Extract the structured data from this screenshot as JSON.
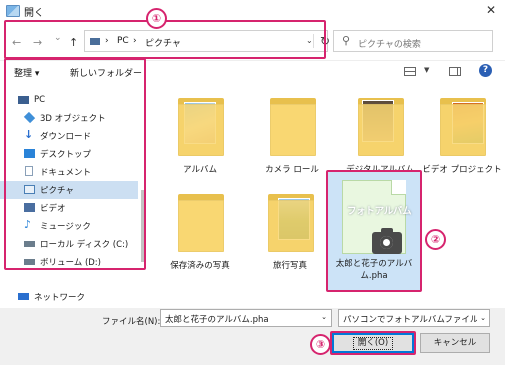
{
  "window": {
    "title": "開く",
    "close_symbol": "✕"
  },
  "nav": {
    "back": "←",
    "forward": "→",
    "recent": "⌄",
    "up": "↑"
  },
  "address": {
    "segments": [
      "PC",
      "›",
      "ピクチャ"
    ],
    "lead_sep": "›",
    "dropdown": "⌄",
    "refresh": "↻"
  },
  "search": {
    "icon": "⚲",
    "placeholder": "ピクチャの検索"
  },
  "toolbar": {
    "organize": "整理 ▾",
    "new_folder": "新しいフォルダー",
    "view_dd": "▼",
    "help": "?"
  },
  "sidebar": {
    "items": [
      {
        "label": "PC",
        "icon": "pc-icon",
        "color": "#3b5f8f"
      },
      {
        "label": "3D オブジェクト",
        "icon": "3d-objects-icon",
        "color": "#3f8fd8"
      },
      {
        "label": "ダウンロード",
        "icon": "download-icon",
        "color": "#2a6fcf"
      },
      {
        "label": "デスクトップ",
        "icon": "desktop-icon",
        "color": "#2a83d8"
      },
      {
        "label": "ドキュメント",
        "icon": "documents-icon",
        "color": "#8aa0b8"
      },
      {
        "label": "ピクチャ",
        "icon": "pictures-icon",
        "color": "#4a7fb5",
        "selected": true
      },
      {
        "label": "ビデオ",
        "icon": "videos-icon",
        "color": "#4a6ea0"
      },
      {
        "label": "ミュージック",
        "icon": "music-icon",
        "color": "#2a83d8"
      },
      {
        "label": "ローカル ディスク (C:)",
        "icon": "local-disk-icon",
        "color": "#6b7d8c"
      },
      {
        "label": "ボリューム (D:)",
        "icon": "volume-icon",
        "color": "#6b7d8c"
      },
      {
        "label": "ネットワーク",
        "icon": "network-icon",
        "color": "#2a6fcf"
      }
    ]
  },
  "folders": [
    {
      "label": "アルバム",
      "photo": "album-photo"
    },
    {
      "label": "カメラ ロール",
      "photo": null
    },
    {
      "label": "デジタルアルバム",
      "photo": "digital-album-photo"
    },
    {
      "label": "ビデオ プロジェクト",
      "photo": "video-project-photo"
    },
    {
      "label": "保存済みの写真",
      "photo": null
    },
    {
      "label": "旅行写真",
      "photo": "travel-photo"
    }
  ],
  "selected_file": {
    "label": "太郎と花子のアルバム.pha",
    "watermark": "フォトアルバム"
  },
  "footer": {
    "filename_label": "ファイル名(N):",
    "filename_value": "太郎と花子のアルバム.pha",
    "filetype_value": "パソコンでフォトアルバムファイル(*.pha)",
    "open_button": "開く(O)",
    "cancel_button": "キャンセル",
    "dropdown": "⌄"
  },
  "callouts": [
    "①",
    "②",
    "③"
  ],
  "colors": {
    "callout": "#d6246e",
    "folder": "#f9d772",
    "selection": "#cce3f7",
    "accent": "#0078d7"
  }
}
